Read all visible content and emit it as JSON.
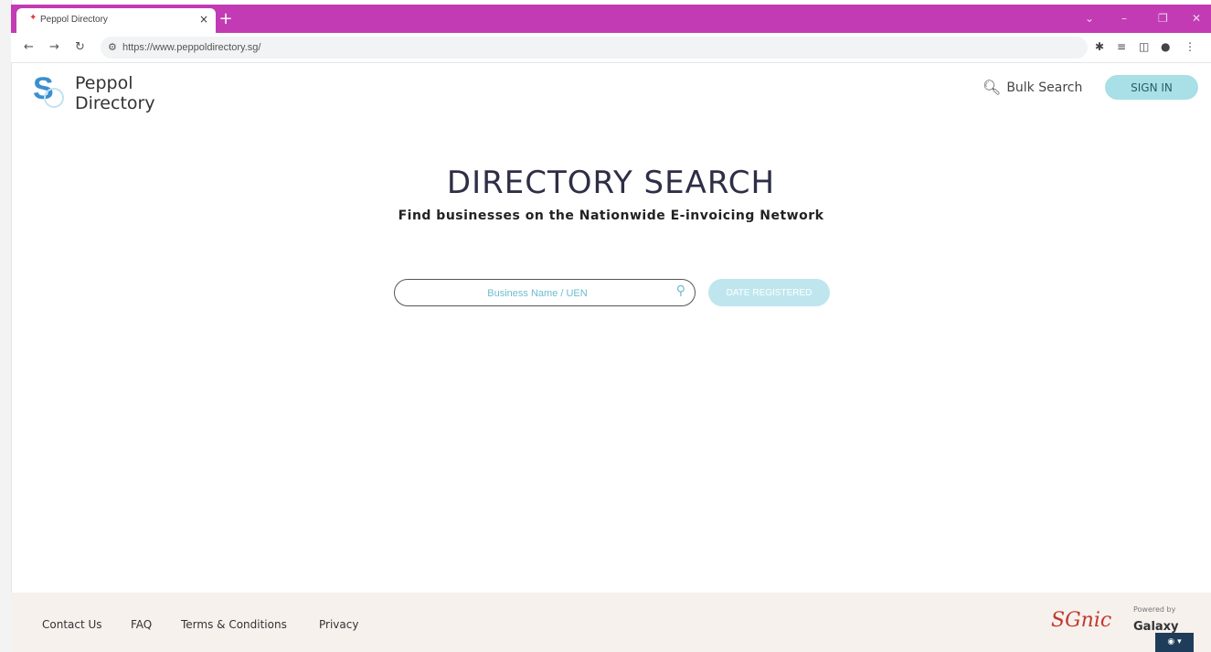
{
  "browser": {
    "tab_title": "Peppol Directory",
    "tab_close": "×",
    "new_tab": "+",
    "url": "https://www.peppoldirectory.sg/",
    "window_controls": {
      "dropdown": "⌄",
      "minimize": "–",
      "restore": "❐",
      "close": "✕"
    }
  },
  "header": {
    "logo_letter": "S",
    "logo_line1": "Peppol",
    "logo_line2": "Directory",
    "bulk_search_label": "Bulk Search",
    "sign_in_label": "SIGN IN"
  },
  "main": {
    "title": "DIRECTORY SEARCH",
    "subtitle": "Find businesses on the Nationwide E-invoicing Network",
    "search_placeholder": "Business Name / UEN",
    "date_button_label": "DATE REGISTERED"
  },
  "footer": {
    "links": [
      "Contact Us",
      "FAQ",
      "Terms & Conditions",
      "Privacy"
    ],
    "sgnic_logo": "SGnic",
    "powered_by": "Powered by",
    "galaxy_logo": "Galaxy"
  },
  "colors": {
    "titlebar": "#c23bb4",
    "accent": "#a9dfe6",
    "footer_bg": "#f7f1ee"
  }
}
